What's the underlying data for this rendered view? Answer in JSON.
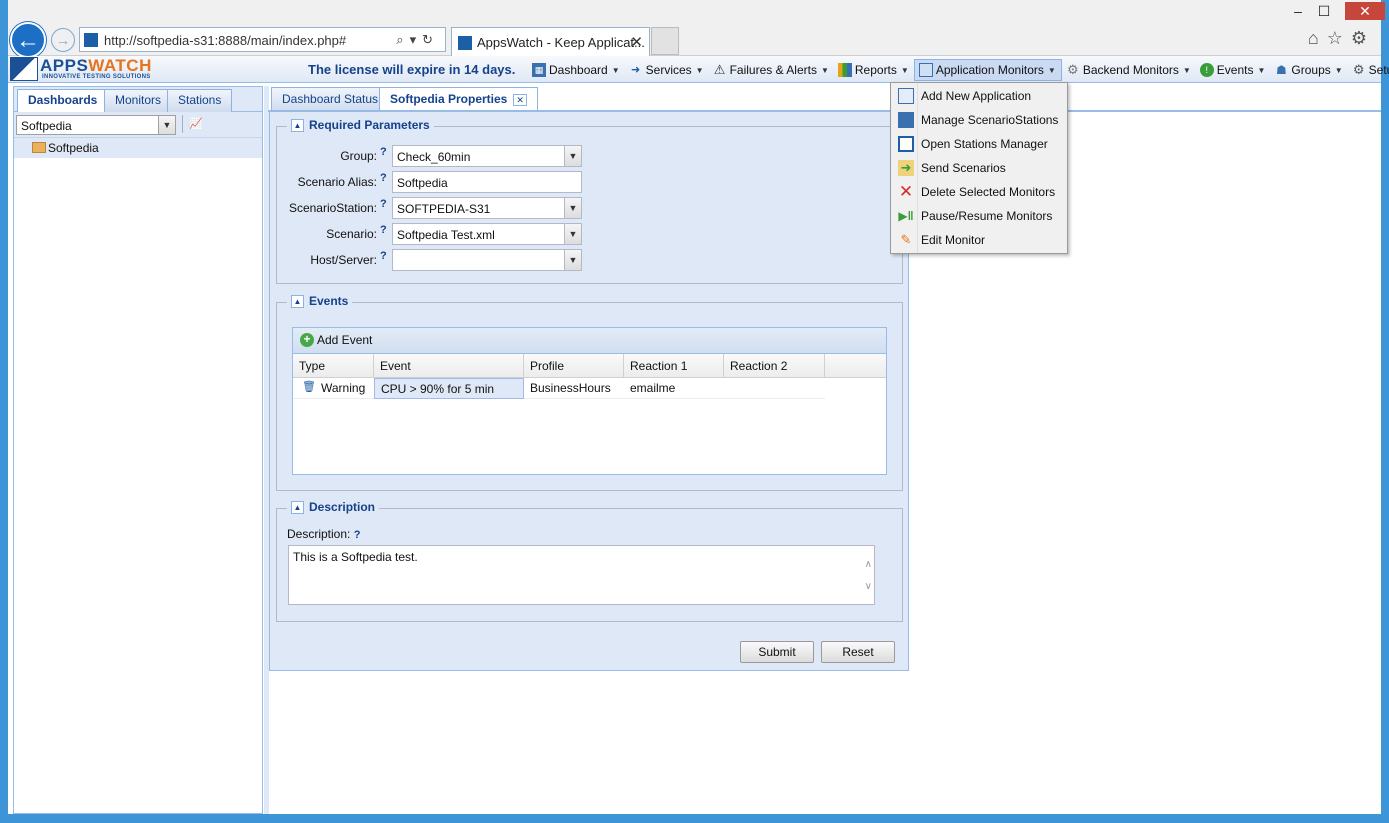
{
  "browser": {
    "url": "http://softpedia-s31:8888/main/index.php#",
    "tab_title": "AppsWatch - Keep Applicat...",
    "tab_close": "✕",
    "window_controls": [
      "–",
      "☐",
      "✕"
    ],
    "icons": [
      "home-icon",
      "star-icon",
      "gear-icon"
    ]
  },
  "app": {
    "logo_main": "APPS",
    "logo_accent": "WATCH",
    "logo_tagline": "INNOVATIVE TESTING SOLUTIONS",
    "license_text": "The license will expire in 14 days."
  },
  "menu": [
    {
      "label": "Dashboard",
      "icon": "dashboard-icon"
    },
    {
      "label": "Services",
      "icon": "services-icon"
    },
    {
      "label": "Failures & Alerts",
      "icon": "warning-icon"
    },
    {
      "label": "Reports",
      "icon": "chart-icon"
    },
    {
      "label": "Application Monitors",
      "icon": "monitor-icon"
    },
    {
      "label": "Backend Monitors",
      "icon": "gears-icon"
    },
    {
      "label": "Events",
      "icon": "events-icon"
    },
    {
      "label": "Groups",
      "icon": "groups-icon"
    },
    {
      "label": "Setup",
      "icon": "gear-icon"
    }
  ],
  "left": {
    "tabs": [
      "Dashboards",
      "Monitors",
      "Stations"
    ],
    "combo_value": "Softpedia",
    "tree_item": "Softpedia"
  },
  "main": {
    "tabs": [
      "Dashboard Status",
      "Softpedia Properties"
    ],
    "required": {
      "legend": "Required Parameters",
      "fields": [
        {
          "label": "Group:",
          "value": "Check_60min",
          "type": "combo"
        },
        {
          "label": "Scenario Alias:",
          "value": "Softpedia",
          "type": "text"
        },
        {
          "label": "ScenarioStation:",
          "value": "SOFTPEDIA-S31",
          "type": "combo"
        },
        {
          "label": "Scenario:",
          "value": "Softpedia Test.xml",
          "type": "combo"
        },
        {
          "label": "Host/Server:",
          "value": "",
          "type": "combo"
        }
      ],
      "help": "?"
    },
    "events": {
      "legend": "Events",
      "add_label": "Add Event",
      "columns": [
        "Type",
        "Event",
        "Profile",
        "Reaction 1",
        "Reaction 2"
      ],
      "rows": [
        {
          "type": "Warning",
          "event": "CPU > 90% for 5 min",
          "profile": "BusinessHours",
          "reaction1": "emailme",
          "reaction2": ""
        }
      ]
    },
    "description": {
      "legend": "Description",
      "label": "Description:",
      "value": "This is a Softpedia test."
    },
    "submit_label": "Submit",
    "reset_label": "Reset"
  },
  "dropdown": [
    {
      "label": "Add New Application",
      "icon": "add-application-icon"
    },
    {
      "label": "Manage ScenarioStations",
      "icon": "station-icon"
    },
    {
      "label": "Open Stations Manager",
      "icon": "stations-manager-icon"
    },
    {
      "label": "Send Scenarios",
      "icon": "send-icon"
    },
    {
      "label": "Delete Selected Monitors",
      "icon": "delete-icon"
    },
    {
      "label": "Pause/Resume Monitors",
      "icon": "pause-resume-icon"
    },
    {
      "label": "Edit Monitor",
      "icon": "edit-icon"
    }
  ]
}
